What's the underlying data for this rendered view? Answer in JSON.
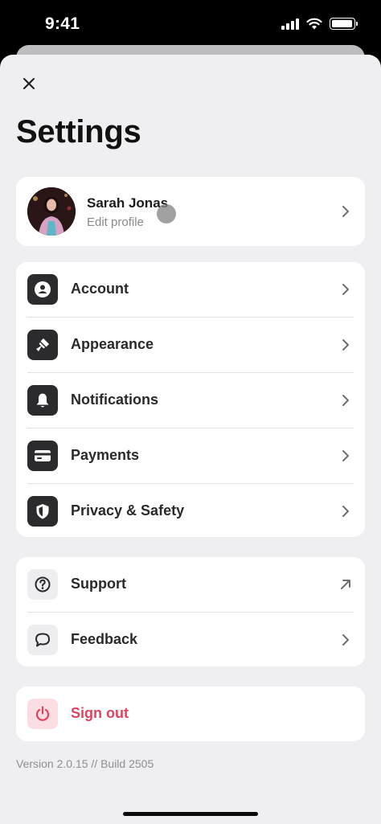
{
  "status_bar": {
    "time": "9:41",
    "battery_level": 0.95,
    "icons": [
      "signal-icon",
      "wifi-icon",
      "battery-icon"
    ]
  },
  "header": {
    "close_icon": "close-icon",
    "title": "Settings"
  },
  "profile": {
    "name": "Sarah Jonas",
    "subtitle": "Edit profile"
  },
  "main_items": [
    {
      "label": "Account",
      "icon": "account-icon"
    },
    {
      "label": "Appearance",
      "icon": "paintbrush-icon"
    },
    {
      "label": "Notifications",
      "icon": "bell-icon"
    },
    {
      "label": "Payments",
      "icon": "credit-card-icon"
    },
    {
      "label": "Privacy & Safety",
      "icon": "shield-icon"
    }
  ],
  "support_items": [
    {
      "label": "Support",
      "icon": "question-icon",
      "trailing": "external-arrow-icon"
    },
    {
      "label": "Feedback",
      "icon": "chat-bubble-icon",
      "trailing": "chevron-right-icon"
    }
  ],
  "signout": {
    "label": "Sign out",
    "icon": "power-icon"
  },
  "footer": {
    "version": "Version 2.0.15 // Build 2505"
  },
  "colors": {
    "background": "#efeef1",
    "card": "#ffffff",
    "icon_tile": "#2b2b2e",
    "destructive": "#e0435e",
    "destructive_tile": "#fbdde3",
    "muted_text": "#8a8a8e"
  }
}
